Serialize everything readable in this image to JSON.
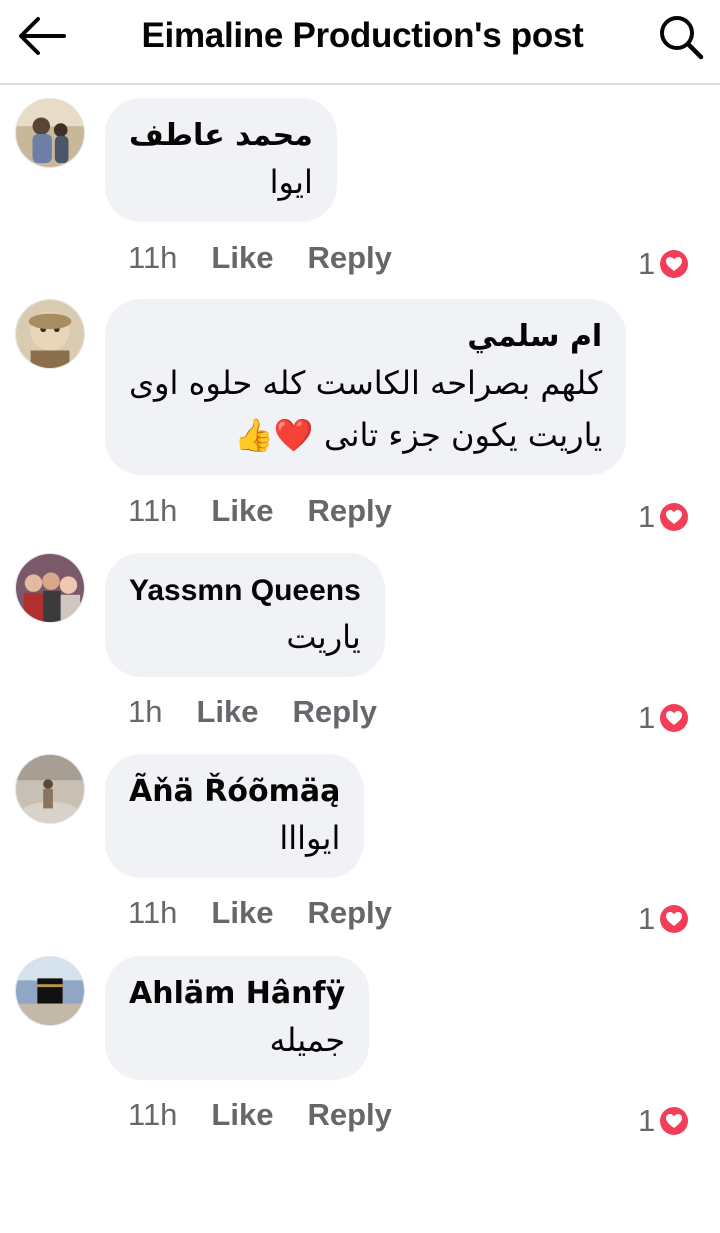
{
  "header": {
    "title": "Eimaline Production's post",
    "back_icon": "arrow-left-icon",
    "search_icon": "search-icon"
  },
  "colors": {
    "bubble": "#f0f2f5",
    "meta_text": "#65676b",
    "love_reaction": "#f33e58",
    "divider": "#dadde1"
  },
  "comments": [
    {
      "author": "محمد عاطف",
      "lines": [
        "ايوا"
      ],
      "time": "11h",
      "like_label": "Like",
      "reply_label": "Reply",
      "reaction_count": "1",
      "reaction_icon": "love-reaction-icon"
    },
    {
      "author": "ام سلمي",
      "lines": [
        "كلهم بصراحه الكاست كله حلوه اوى",
        "ياريت يكون جزء تانى ❤️👍"
      ],
      "time": "11h",
      "like_label": "Like",
      "reply_label": "Reply",
      "reaction_count": "1",
      "reaction_icon": "love-reaction-icon"
    },
    {
      "author": "Yassmn Queens",
      "lines": [
        "ياريت"
      ],
      "time": "1h",
      "like_label": "Like",
      "reply_label": "Reply",
      "reaction_count": "1",
      "reaction_icon": "love-reaction-icon"
    },
    {
      "author": "Ãňä Řóõmäą",
      "lines": [
        "ايوااا"
      ],
      "time": "11h",
      "like_label": "Like",
      "reply_label": "Reply",
      "reaction_count": "1",
      "reaction_icon": "love-reaction-icon"
    },
    {
      "author": "Ahläm Hânfÿ",
      "lines": [
        "جميله"
      ],
      "time": "11h",
      "like_label": "Like",
      "reply_label": "Reply",
      "reaction_count": "1",
      "reaction_icon": "love-reaction-icon"
    }
  ]
}
